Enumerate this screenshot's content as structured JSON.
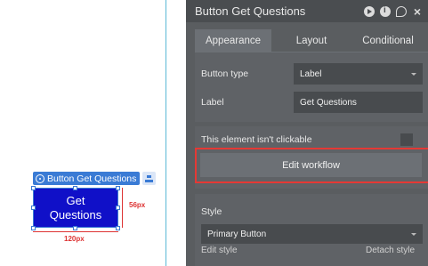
{
  "canvas": {
    "selection_label": "Button Get Questions",
    "button_text": "Get Questions",
    "height_dim": "56px",
    "width_dim": "120px"
  },
  "panel": {
    "title": "Button Get Questions",
    "tabs": [
      "Appearance",
      "Layout",
      "Conditional"
    ],
    "button_type_label": "Button type",
    "button_type_value": "Label",
    "label_label": "Label",
    "label_value": "Get Questions",
    "not_clickable_label": "This element isn't clickable",
    "edit_workflow": "Edit workflow",
    "style_label": "Style",
    "style_value": "Primary Button",
    "edit_style": "Edit style",
    "detach_style": "Detach style"
  },
  "colors": {
    "button_fill": "#1010c8",
    "selection": "#3a7bd5",
    "highlight": "#e53935",
    "panel": "#5a5d60"
  }
}
